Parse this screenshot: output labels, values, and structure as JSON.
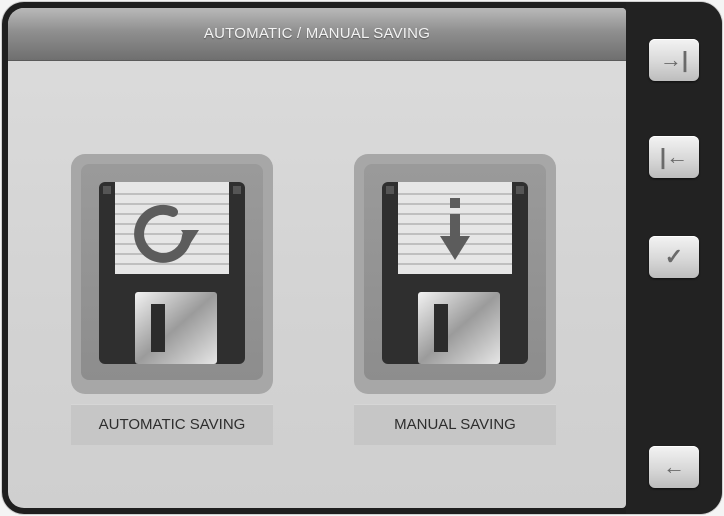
{
  "header": {
    "title": "AUTOMATIC / MANUAL SAVING"
  },
  "options": [
    {
      "label": "AUTOMATIC SAVING",
      "icon": "floppy-disk-refresh-icon"
    },
    {
      "label": "MANUAL SAVING",
      "icon": "floppy-disk-download-icon"
    }
  ],
  "sidebar": {
    "buttons": [
      {
        "glyph": "→|",
        "icon": "arrow-right-bar-icon"
      },
      {
        "glyph": "|←",
        "icon": "bar-arrow-left-icon"
      },
      {
        "glyph": "✓",
        "icon": "check-icon"
      },
      {
        "glyph": "←",
        "icon": "back-arrow-icon"
      }
    ]
  },
  "colors": {
    "frame": "#1f1f1f",
    "panel": "#d5d5d5",
    "titlebar": "#8f8f8f",
    "accent_text": "#f3f3f3"
  }
}
